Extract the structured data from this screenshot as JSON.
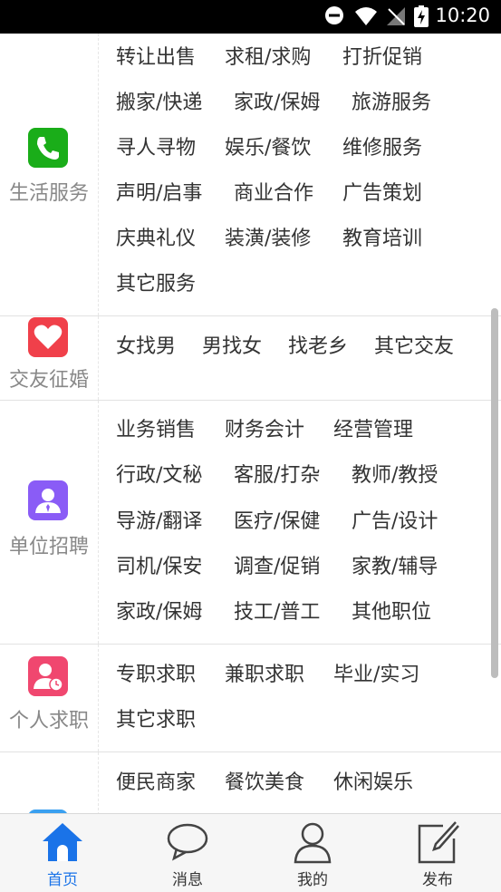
{
  "status_bar": {
    "time": "10:20"
  },
  "sections": [
    {
      "name": "生活服务",
      "icon": "phone-icon",
      "color": "#1aad19",
      "items": [
        "转让出售",
        "求租/求购",
        "打折促销",
        "搬家/快递",
        "家政/保姆",
        "旅游服务",
        "寻人寻物",
        "娱乐/餐饮",
        "维修服务",
        "声明/启事",
        "商业合作",
        "广告策划",
        "庆典礼仪",
        "装潢/装修",
        "教育培训",
        "其它服务"
      ]
    },
    {
      "name": "交友征婚",
      "icon": "heart-icon",
      "color": "#f0404a",
      "items": [
        "女找男",
        "男找女",
        "找老乡",
        "其它交友"
      ]
    },
    {
      "name": "单位招聘",
      "icon": "person-icon",
      "color": "#8a5cf6",
      "items": [
        "业务销售",
        "财务会计",
        "经营管理",
        "行政/文秘",
        "客服/打杂",
        "教师/教授",
        "导游/翻译",
        "医疗/保健",
        "广告/设计",
        "司机/保安",
        "调查/促销",
        "家教/辅导",
        "家政/保姆",
        "技工/普工",
        "其他职位"
      ]
    },
    {
      "name": "个人求职",
      "icon": "person-clock-icon",
      "color": "#f0476f",
      "items": [
        "专职求职",
        "兼职求职",
        "毕业/实习",
        "其它求职"
      ]
    },
    {
      "name": "",
      "icon": "shop-icon",
      "color": "#3aa0f0",
      "items": [
        "便民商家",
        "餐饮美食",
        "休闲娱乐"
      ]
    }
  ],
  "nav": {
    "items": [
      {
        "label": "首页",
        "icon": "home-icon",
        "active": true
      },
      {
        "label": "消息",
        "icon": "message-icon",
        "active": false
      },
      {
        "label": "我的",
        "icon": "user-icon",
        "active": false
      },
      {
        "label": "发布",
        "icon": "edit-icon",
        "active": false
      }
    ],
    "active_color": "#1a73e8"
  }
}
